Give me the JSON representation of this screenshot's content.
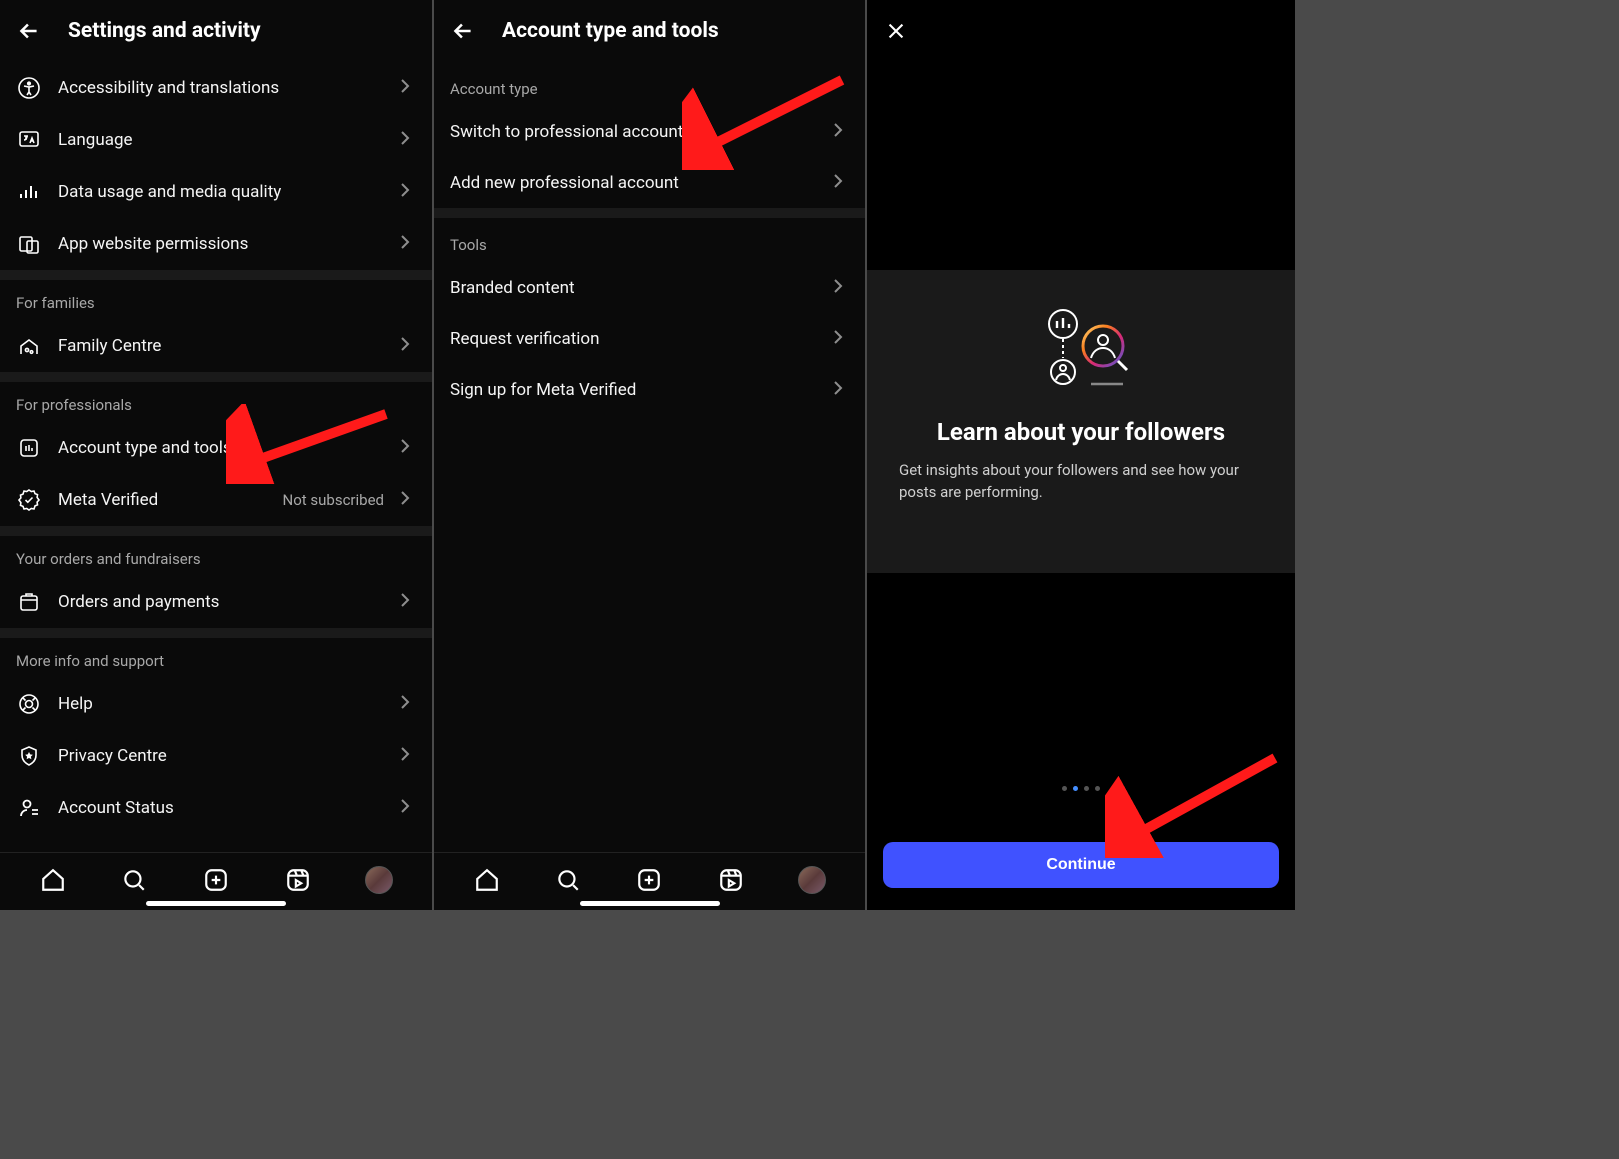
{
  "phone1": {
    "header": {
      "title": "Settings and activity"
    },
    "rows_top": [
      {
        "icon": "accessibility-icon",
        "label": "Accessibility and translations"
      },
      {
        "icon": "language-icon",
        "label": "Language"
      },
      {
        "icon": "data-usage-icon",
        "label": "Data usage and media quality"
      },
      {
        "icon": "permissions-icon",
        "label": "App website permissions"
      }
    ],
    "section_families": {
      "title": "For families",
      "rows": [
        {
          "icon": "family-centre-icon",
          "label": "Family Centre"
        }
      ]
    },
    "section_professionals": {
      "title": "For professionals",
      "rows": [
        {
          "icon": "account-tools-icon",
          "label": "Account type and tools"
        },
        {
          "icon": "meta-verified-icon",
          "label": "Meta Verified",
          "sub": "Not subscribed"
        }
      ]
    },
    "section_orders": {
      "title": "Your orders and fundraisers",
      "rows": [
        {
          "icon": "orders-icon",
          "label": "Orders and payments"
        }
      ]
    },
    "section_support": {
      "title": "More info and support",
      "rows": [
        {
          "icon": "help-icon",
          "label": "Help"
        },
        {
          "icon": "privacy-centre-icon",
          "label": "Privacy Centre"
        },
        {
          "icon": "account-status-icon",
          "label": "Account Status"
        }
      ]
    }
  },
  "phone2": {
    "header": {
      "title": "Account type and tools"
    },
    "section_account_type": {
      "title": "Account type",
      "rows": [
        {
          "label": "Switch to professional account"
        },
        {
          "label": "Add new professional account"
        }
      ]
    },
    "section_tools": {
      "title": "Tools",
      "rows": [
        {
          "label": "Branded content"
        },
        {
          "label": "Request verification"
        },
        {
          "label": "Sign up for Meta Verified"
        }
      ]
    }
  },
  "phone3": {
    "card": {
      "title": "Learn about your followers",
      "desc": "Get insights about your followers and see how your posts are performing."
    },
    "continue_label": "Continue"
  }
}
